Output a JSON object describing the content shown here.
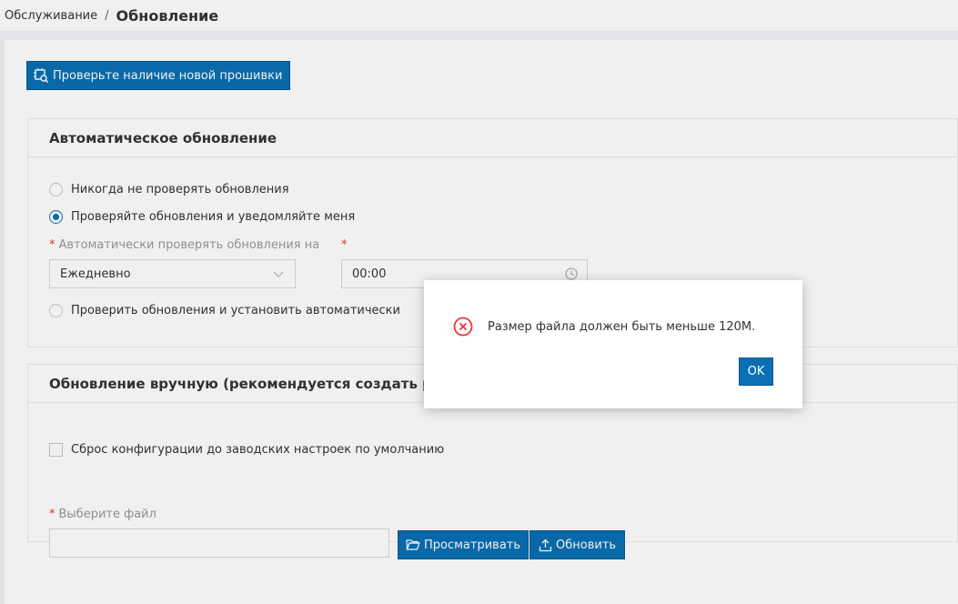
{
  "breadcrumb": {
    "parent": "Обслуживание",
    "separator": "/",
    "current": "Обновление"
  },
  "toolbar": {
    "check_firmware_label": "Проверьте наличие новой прошивки",
    "check_firmware_icon": "firmware-check-icon"
  },
  "auto_update": {
    "title": "Автоматическое обновление",
    "options": [
      {
        "label": "Никогда не проверять обновления",
        "checked": false
      },
      {
        "label": "Проверяйте обновления и уведомляйте меня",
        "checked": true
      },
      {
        "label": "Проверить обновления и установить автоматически",
        "checked": false
      }
    ],
    "interval_label": "Автоматически проверять обновления на",
    "interval_value": "Ежедневно",
    "time_value": "00:00",
    "required_mark": "*"
  },
  "manual_update": {
    "title": "Обновление вручную (рекомендуется создать резерв",
    "reset_label": "Сброс конфигурации до заводских настроек по умолчанию",
    "reset_checked": false,
    "file_label": "Выберите файл",
    "file_value": "",
    "browse_label": "Просматривать",
    "update_label": "Обновить"
  },
  "dialog": {
    "message": "Размер файла должен быть меньше 120M.",
    "ok_label": "OK",
    "icon": "error-circle-icon"
  },
  "colors": {
    "primary": "#0a70b3",
    "error": "#e4393c"
  }
}
